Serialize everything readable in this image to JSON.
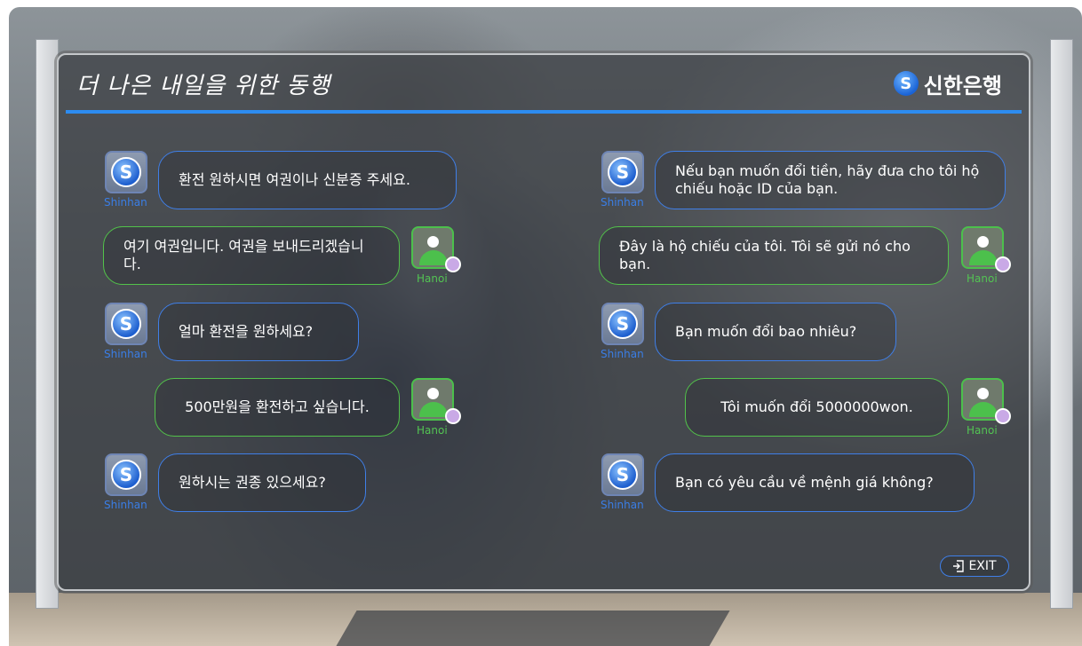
{
  "header": {
    "slogan": "더 나은 내일을 위한 동행",
    "brand_name": "신한은행",
    "brand_logo_glyph": "S"
  },
  "labels": {
    "bank": "Shinhan",
    "user": "Hanoi"
  },
  "conversation_korean": [
    {
      "speaker": "bank",
      "text": "환전 원하시면 여권이나 신분증 주세요."
    },
    {
      "speaker": "user",
      "text": "여기 여권입니다. 여권을 보내드리겠습니다."
    },
    {
      "speaker": "bank",
      "text": "얼마 환전을 원하세요?"
    },
    {
      "speaker": "user",
      "text": "500만원을 환전하고 싶습니다."
    },
    {
      "speaker": "bank",
      "text": "원하시는 권종 있으세요?"
    }
  ],
  "conversation_vietnamese": [
    {
      "speaker": "bank",
      "text": "Nếu bạn muốn đổi tiền, hãy đưa cho tôi hộ chiếu hoặc ID của bạn."
    },
    {
      "speaker": "user",
      "text": "Đây là hộ chiếu của tôi. Tôi sẽ gửi nó cho bạn."
    },
    {
      "speaker": "bank",
      "text": "Bạn muốn đổi bao nhiêu?"
    },
    {
      "speaker": "user",
      "text": "Tôi muốn đổi 5000000won."
    },
    {
      "speaker": "bank",
      "text": "Bạn có yêu cầu về mệnh giá không?"
    }
  ],
  "exit": {
    "label": "EXIT",
    "icon": "exit-icon"
  },
  "colors": {
    "bank_accent": "#3f7fe8",
    "user_accent": "#52c24a",
    "status_dot": "#c9a9e6",
    "header_line": "#2d8cf0"
  }
}
